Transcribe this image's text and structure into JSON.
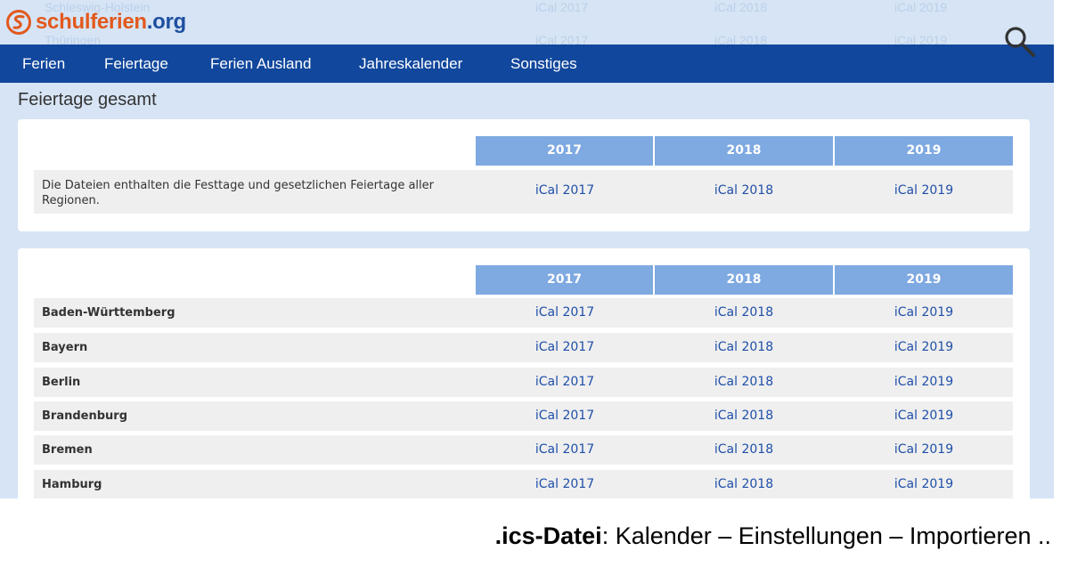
{
  "site": {
    "logo_part1": "schul",
    "logo_part2": "ferien",
    "logo_part3": ".org"
  },
  "ghost_rows": [
    {
      "label": "Schleswig-Holstein",
      "c1": "iCal 2017",
      "c2": "iCal 2018",
      "c3": "iCal 2019"
    },
    {
      "label": "Thüringen",
      "c1": "iCal 2017",
      "c2": "iCal 2018",
      "c3": "iCal 2019"
    }
  ],
  "nav": [
    "Ferien",
    "Feiertage",
    "Ferien Ausland",
    "Jahreskalender",
    "Sonstiges"
  ],
  "page_title": "Feiertage gesamt",
  "years": [
    "2017",
    "2018",
    "2019"
  ],
  "summary": {
    "description": "Die Dateien enthalten die Festtage und gesetzlichen Feiertage aller Regionen.",
    "links": [
      "iCal 2017",
      "iCal 2018",
      "iCal 2019"
    ]
  },
  "regions": [
    {
      "name": "Baden-Württemberg",
      "links": [
        "iCal 2017",
        "iCal 2018",
        "iCal 2019"
      ]
    },
    {
      "name": "Bayern",
      "links": [
        "iCal 2017",
        "iCal 2018",
        "iCal 2019"
      ]
    },
    {
      "name": "Berlin",
      "links": [
        "iCal 2017",
        "iCal 2018",
        "iCal 2019"
      ]
    },
    {
      "name": "Brandenburg",
      "links": [
        "iCal 2017",
        "iCal 2018",
        "iCal 2019"
      ]
    },
    {
      "name": "Bremen",
      "links": [
        "iCal 2017",
        "iCal 2018",
        "iCal 2019"
      ]
    },
    {
      "name": "Hamburg",
      "links": [
        "iCal 2017",
        "iCal 2018",
        "iCal 2019"
      ]
    }
  ],
  "caption": {
    "bold": ".ics-Datei",
    "rest": ": Kalender – Einstellungen – Importieren .."
  },
  "colors": {
    "nav_bg": "#11479c",
    "header_cell": "#7ea9e1",
    "link": "#1f4fa8",
    "logo_orange": "#e2591d",
    "page_bg": "#d6e4f5"
  }
}
